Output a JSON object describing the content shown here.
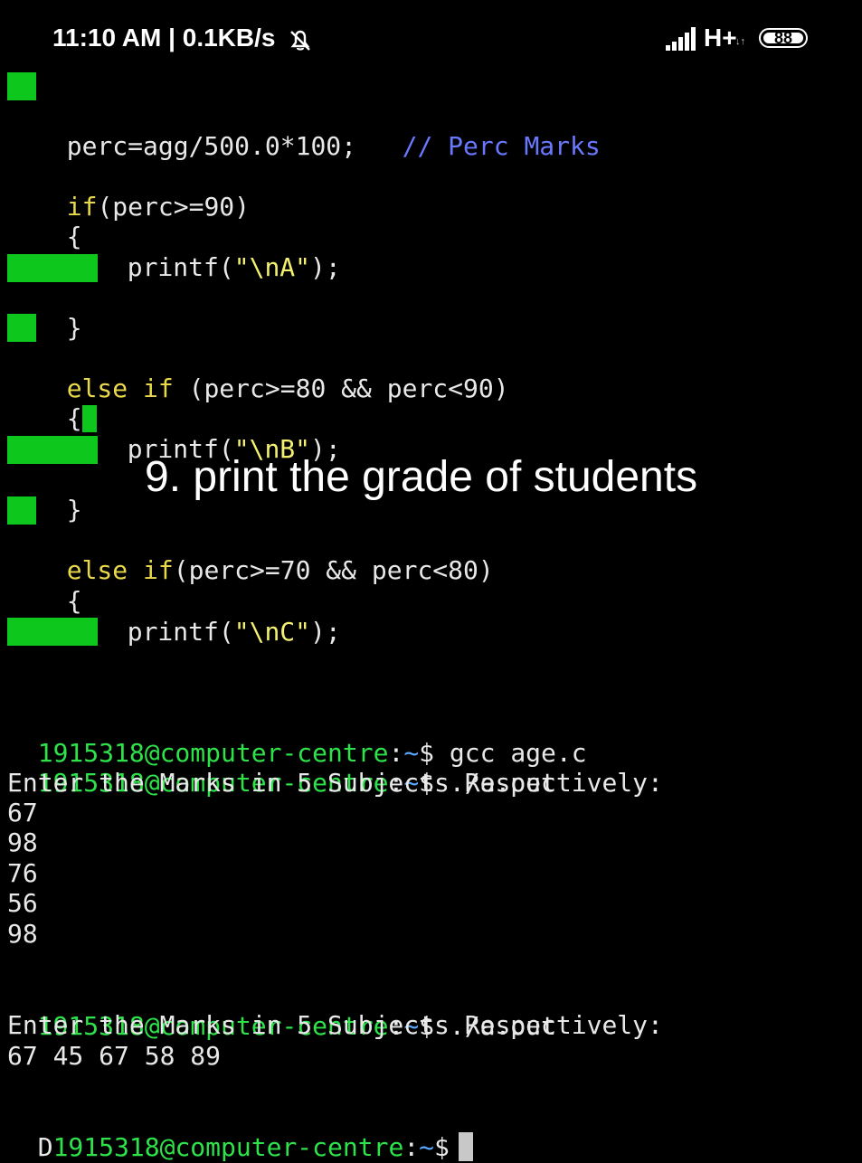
{
  "status_bar": {
    "time": "11:10 AM | 0.1KB/s",
    "network": "H+",
    "battery": "88"
  },
  "code": {
    "line1_code": "perc=agg/500.0*100;",
    "line1_comment": "// Perc Marks",
    "if1_kw": "if",
    "if1_cond": "(perc>=90)",
    "brace_open": "{",
    "brace_close": "}",
    "printf": "printf(",
    "str_a": "\"\\nA\"",
    "str_b": "\"\\nB\"",
    "str_c": "\"\\nC\"",
    "close_paren": ");",
    "else_if1_kw": "else if",
    "else_if1_cond": " (perc>=80 && perc<90)",
    "else_if2_kw": "else if",
    "else_if2_cond": "(perc>=70 && perc<80)"
  },
  "overlay_text": "9. print the grade of students",
  "terminal": {
    "prompt_user": "1915318@computer-centre",
    "prompt_sep": ":",
    "prompt_path": "~",
    "prompt_symbol": "$",
    "cmd1": "gcc age.c",
    "cmd2": "./a.out",
    "output_prompt": "Enter the Marks in 5 Subjects Respectively:",
    "marks_inputs": [
      "67",
      "98",
      "76",
      "56",
      "98"
    ],
    "cmd3": "./a.out",
    "output_prompt2": "Enter the Marks in 5 Subjects Respectively:",
    "marks_line": "67 45 67 58 89",
    "last_prefix": "D",
    "last_user": "1915318@computer-centre"
  }
}
